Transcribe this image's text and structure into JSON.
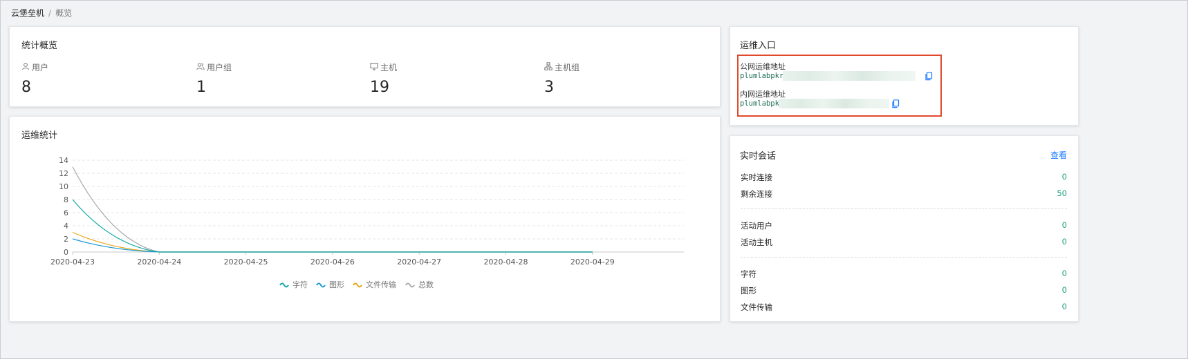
{
  "breadcrumb": {
    "root": "云堡垒机",
    "separator": "/",
    "current": "概览"
  },
  "overview": {
    "title": "统计概览",
    "stats": [
      {
        "label": "用户",
        "value": "8",
        "icon": "user-icon"
      },
      {
        "label": "用户组",
        "value": "1",
        "icon": "user-group-icon"
      },
      {
        "label": "主机",
        "value": "19",
        "icon": "monitor-icon"
      },
      {
        "label": "主机组",
        "value": "3",
        "icon": "host-group-icon"
      }
    ]
  },
  "ops_stats": {
    "title": "运维统计"
  },
  "chart_data": {
    "type": "line",
    "x": [
      "2020-04-23",
      "2020-04-24",
      "2020-04-25",
      "2020-04-26",
      "2020-04-27",
      "2020-04-28",
      "2020-04-29"
    ],
    "ylim": [
      0,
      14
    ],
    "yticks": [
      0,
      2,
      4,
      6,
      8,
      10,
      12,
      14
    ],
    "grid": true,
    "legend_position": "bottom",
    "series": [
      {
        "name": "字符",
        "values": [
          8,
          0,
          0,
          0,
          0,
          0,
          0
        ],
        "color": "#13a8a8"
      },
      {
        "name": "图形",
        "values": [
          2,
          0,
          0,
          0,
          0,
          0,
          0
        ],
        "color": "#1d9ad6"
      },
      {
        "name": "文件传输",
        "values": [
          3,
          0,
          0,
          0,
          0,
          0,
          0
        ],
        "color": "#e6a817"
      },
      {
        "name": "总数",
        "values": [
          13,
          0,
          0,
          0,
          0,
          0,
          0
        ],
        "color": "#aaaaaa"
      }
    ]
  },
  "ops_entry": {
    "title": "运维入口",
    "public_label": "公网运维地址",
    "public_address": "plumlabpkr",
    "private_label": "内网运维地址",
    "private_address": "plumlabpk"
  },
  "sessions": {
    "title": "实时会话",
    "view_link": "查看",
    "groups": [
      [
        {
          "label": "实时连接",
          "value": "0"
        },
        {
          "label": "剩余连接",
          "value": "50"
        }
      ],
      [
        {
          "label": "活动用户",
          "value": "0"
        },
        {
          "label": "活动主机",
          "value": "0"
        }
      ],
      [
        {
          "label": "字符",
          "value": "0"
        },
        {
          "label": "图形",
          "value": "0"
        },
        {
          "label": "文件传输",
          "value": "0"
        }
      ]
    ]
  },
  "colors": {
    "accent": "#1677ff",
    "value_green": "#1a9c7a",
    "highlight_border": "#e0492c"
  }
}
